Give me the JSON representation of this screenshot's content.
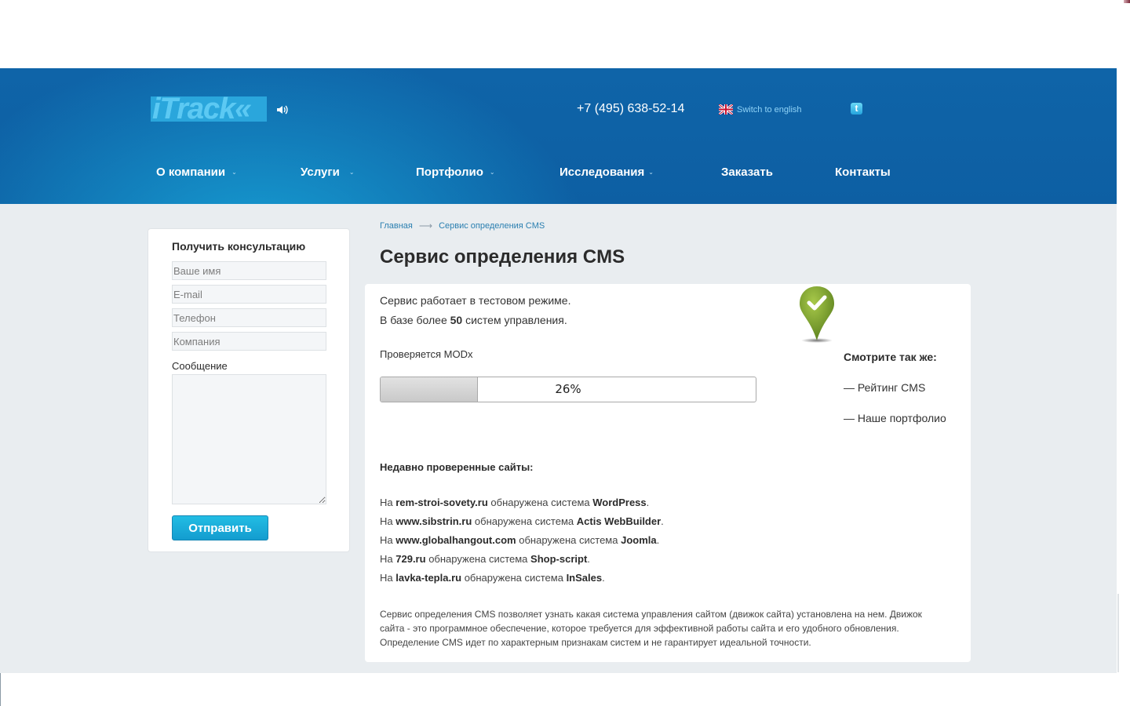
{
  "header": {
    "logo_text": "iTrack",
    "phone": "+7 (495) 638-52-14",
    "lang_switch": "Switch to english",
    "icons": {
      "sound": "sound-icon",
      "flag": "uk-flag-icon",
      "social": "twitter-icon"
    }
  },
  "nav": {
    "items": [
      {
        "label": "О компании",
        "has_dropdown": true
      },
      {
        "label": "Услуги",
        "has_dropdown": true
      },
      {
        "label": "Портфолио",
        "has_dropdown": true
      },
      {
        "label": "Исследования",
        "has_dropdown": true
      },
      {
        "label": "Заказать",
        "has_dropdown": false
      },
      {
        "label": "Контакты",
        "has_dropdown": false
      }
    ],
    "chevron": "⌄"
  },
  "sidebar": {
    "title": "Получить консультацию",
    "fields": {
      "name": {
        "placeholder": "Ваше имя",
        "value": ""
      },
      "email": {
        "placeholder": "E-mail",
        "value": ""
      },
      "phone": {
        "placeholder": "Телефон",
        "value": ""
      },
      "company": {
        "placeholder": "Компания",
        "value": ""
      }
    },
    "message_label": "Сообщение",
    "message_value": "",
    "submit_label": "Отправить"
  },
  "breadcrumb": {
    "home": "Главная",
    "separator": "⟶",
    "current": "Сервис определения CMS"
  },
  "page_title": "Сервис определения CMS",
  "main": {
    "intro_line1": "Сервис работает в тестовом режиме.",
    "intro_line2_prefix": "В базе более",
    "intro_line2_count": "50",
    "intro_line2_suffix": "систем управления.",
    "checking_label": "Проверяется MODx",
    "progress": {
      "percent": 26,
      "label": "26%"
    },
    "see_also": {
      "title": "Смотрите так же:",
      "links": [
        "— Рейтинг CMS",
        "— Наше портфолио"
      ]
    },
    "recent": {
      "title": "Недавно проверенные сайты:",
      "prefix": "На",
      "middle": "обнаружена система",
      "items": [
        {
          "site": "rem-stroi-sovety.ru",
          "cms": "WordPress"
        },
        {
          "site": "www.sibstrin.ru",
          "cms": "Actis WebBuilder"
        },
        {
          "site": "www.globalhangout.com",
          "cms": "Joomla"
        },
        {
          "site": "729.ru",
          "cms": "Shop-script"
        },
        {
          "site": "lavka-tepla.ru",
          "cms": "InSales"
        }
      ]
    },
    "description": "Сервис определения CMS позволяет узнать какая система управления сайтом (движок сайта) установлена на нем. Движок сайта - это программное обеспечение, которое требуется для эффективной работы сайта и его удобного обновления. Определение CMS идет по характерным признакам систем и не гарантирует идеальной точности."
  },
  "colors": {
    "header_blue": "#0d5fa3",
    "header_light": "#19aadc",
    "content_bg": "#e9edf0",
    "link": "#2a7fb0",
    "button": "#139ccf",
    "pin_green": "#7a9e2a"
  }
}
